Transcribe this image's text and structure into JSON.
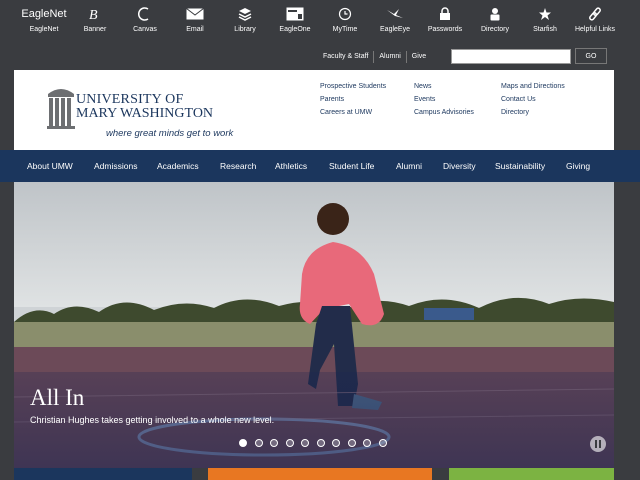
{
  "utility": {
    "items": [
      {
        "id": "eaglenet",
        "label": "EagleNet",
        "icon": "eaglenet-wordmark",
        "word": "EagleNet"
      },
      {
        "id": "banner",
        "label": "Banner",
        "icon": "banner-b-icon"
      },
      {
        "id": "canvas",
        "label": "Canvas",
        "icon": "canvas-c-icon"
      },
      {
        "id": "email",
        "label": "Email",
        "icon": "envelope-icon"
      },
      {
        "id": "library",
        "label": "Library",
        "icon": "books-icon"
      },
      {
        "id": "eagleone",
        "label": "EagleOne",
        "icon": "id-card-icon"
      },
      {
        "id": "mytime",
        "label": "MyTime",
        "icon": "clock-icon"
      },
      {
        "id": "eagleeye",
        "label": "EagleEye",
        "icon": "eagle-icon"
      },
      {
        "id": "passwords",
        "label": "Passwords",
        "icon": "lock-icon"
      },
      {
        "id": "directory",
        "label": "Directory",
        "icon": "person-icon"
      },
      {
        "id": "starfish",
        "label": "Starfish",
        "icon": "starfish-icon"
      },
      {
        "id": "helpful",
        "label": "Helpful Links",
        "icon": "link-icon"
      }
    ]
  },
  "sublinks": {
    "faculty": "Faculty & Staff",
    "alumni": "Alumni",
    "give": "Give"
  },
  "search": {
    "placeholder": "",
    "go_label": "GO"
  },
  "header": {
    "logo_line1": "UNIVERSITY OF",
    "logo_line2": "MARY WASHINGTON",
    "tagline": "where great minds get to work",
    "col1": [
      "Prospective Students",
      "Parents",
      "Careers at UMW"
    ],
    "col2": [
      "News",
      "Events",
      "Campus Advisories"
    ],
    "col3": [
      "Maps and Directions",
      "Contact Us",
      "Directory"
    ]
  },
  "nav": [
    "About UMW",
    "Admissions",
    "Academics",
    "Research",
    "Athletics",
    "Student Life",
    "Alumni",
    "Diversity",
    "Sustainability",
    "Giving"
  ],
  "hero": {
    "title": "All In",
    "subtitle": "Christian Hughes takes getting involved to a whole new level.",
    "slide_count": 10,
    "active_slide": 1
  },
  "colors": {
    "navy": "#1b365d",
    "dark_bg": "#3a3c40",
    "tile_orange": "#e87722",
    "tile_green": "#7cb342",
    "tile_navy": "#1b365d"
  }
}
